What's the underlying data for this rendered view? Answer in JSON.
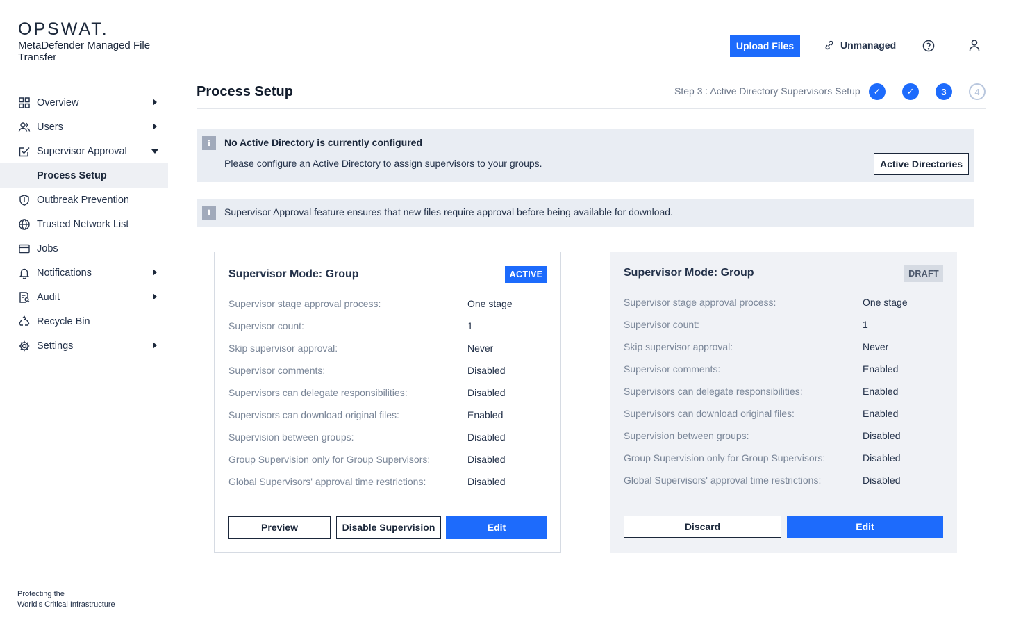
{
  "brand": {
    "logo": "OPSWAT.",
    "product": "MetaDefender Managed File Transfer",
    "tagline_line1": "Protecting the",
    "tagline_line2": "World's Critical Infrastructure"
  },
  "header": {
    "upload_label": "Upload Files",
    "unmanaged_label": "Unmanaged"
  },
  "sidebar": {
    "items": [
      {
        "label": "Overview",
        "icon": "grid-icon"
      },
      {
        "label": "Users",
        "icon": "users-icon"
      },
      {
        "label": "Supervisor Approval",
        "icon": "approval-icon"
      },
      {
        "label": "Process Setup"
      },
      {
        "label": "Outbreak Prevention",
        "icon": "shield-icon"
      },
      {
        "label": "Trusted Network List",
        "icon": "globe-icon"
      },
      {
        "label": "Jobs",
        "icon": "jobs-icon"
      },
      {
        "label": "Notifications",
        "icon": "bell-icon"
      },
      {
        "label": "Audit",
        "icon": "audit-icon"
      },
      {
        "label": "Recycle Bin",
        "icon": "recycle-icon"
      },
      {
        "label": "Settings",
        "icon": "gear-icon"
      }
    ]
  },
  "main": {
    "title": "Process Setup",
    "step_label": "Step 3 : Active Directory Supervisors Setup",
    "steps": [
      "✓",
      "✓",
      "3",
      "4"
    ],
    "banner_ad": {
      "title": "No Active Directory is currently configured",
      "text": "Please configure an Active Directory to assign supervisors to your groups.",
      "button": "Active Directories"
    },
    "banner_info": {
      "text": "Supervisor Approval feature ensures that new files require approval before being available for download."
    },
    "active_card": {
      "title": "Supervisor Mode: Group",
      "badge": "ACTIVE",
      "rows": [
        {
          "label": "Supervisor stage approval process:",
          "value": "One stage"
        },
        {
          "label": "Supervisor count:",
          "value": "1"
        },
        {
          "label": "Skip supervisor approval:",
          "value": "Never"
        },
        {
          "label": "Supervisor comments:",
          "value": "Disabled"
        },
        {
          "label": "Supervisors can delegate responsibilities:",
          "value": "Disabled"
        },
        {
          "label": "Supervisors can download original files:",
          "value": "Enabled"
        },
        {
          "label": "Supervision between groups:",
          "value": "Disabled"
        },
        {
          "label": "Group Supervision only for Group Supervisors:",
          "value": "Disabled"
        },
        {
          "label": "Global Supervisors' approval time restrictions:",
          "value": "Disabled"
        }
      ],
      "preview_label": "Preview",
      "disable_label": "Disable Supervision",
      "edit_label": "Edit"
    },
    "draft_card": {
      "title": "Supervisor Mode: Group",
      "badge": "DRAFT",
      "rows": [
        {
          "label": "Supervisor stage approval process:",
          "value": "One stage"
        },
        {
          "label": "Supervisor count:",
          "value": "1"
        },
        {
          "label": "Skip supervisor approval:",
          "value": "Never"
        },
        {
          "label": "Supervisor comments:",
          "value": "Enabled"
        },
        {
          "label": "Supervisors can delegate responsibilities:",
          "value": "Enabled"
        },
        {
          "label": "Supervisors can download original files:",
          "value": "Enabled"
        },
        {
          "label": "Supervision between groups:",
          "value": "Disabled"
        },
        {
          "label": "Group Supervision only for Group Supervisors:",
          "value": "Disabled"
        },
        {
          "label": "Global Supervisors' approval time restrictions:",
          "value": "Disabled"
        }
      ],
      "discard_label": "Discard",
      "edit_label": "Edit"
    }
  },
  "colors": {
    "accent": "#1d6bfc",
    "banner_bg": "#e9edf3",
    "draft_bg": "#f0f2f6"
  }
}
